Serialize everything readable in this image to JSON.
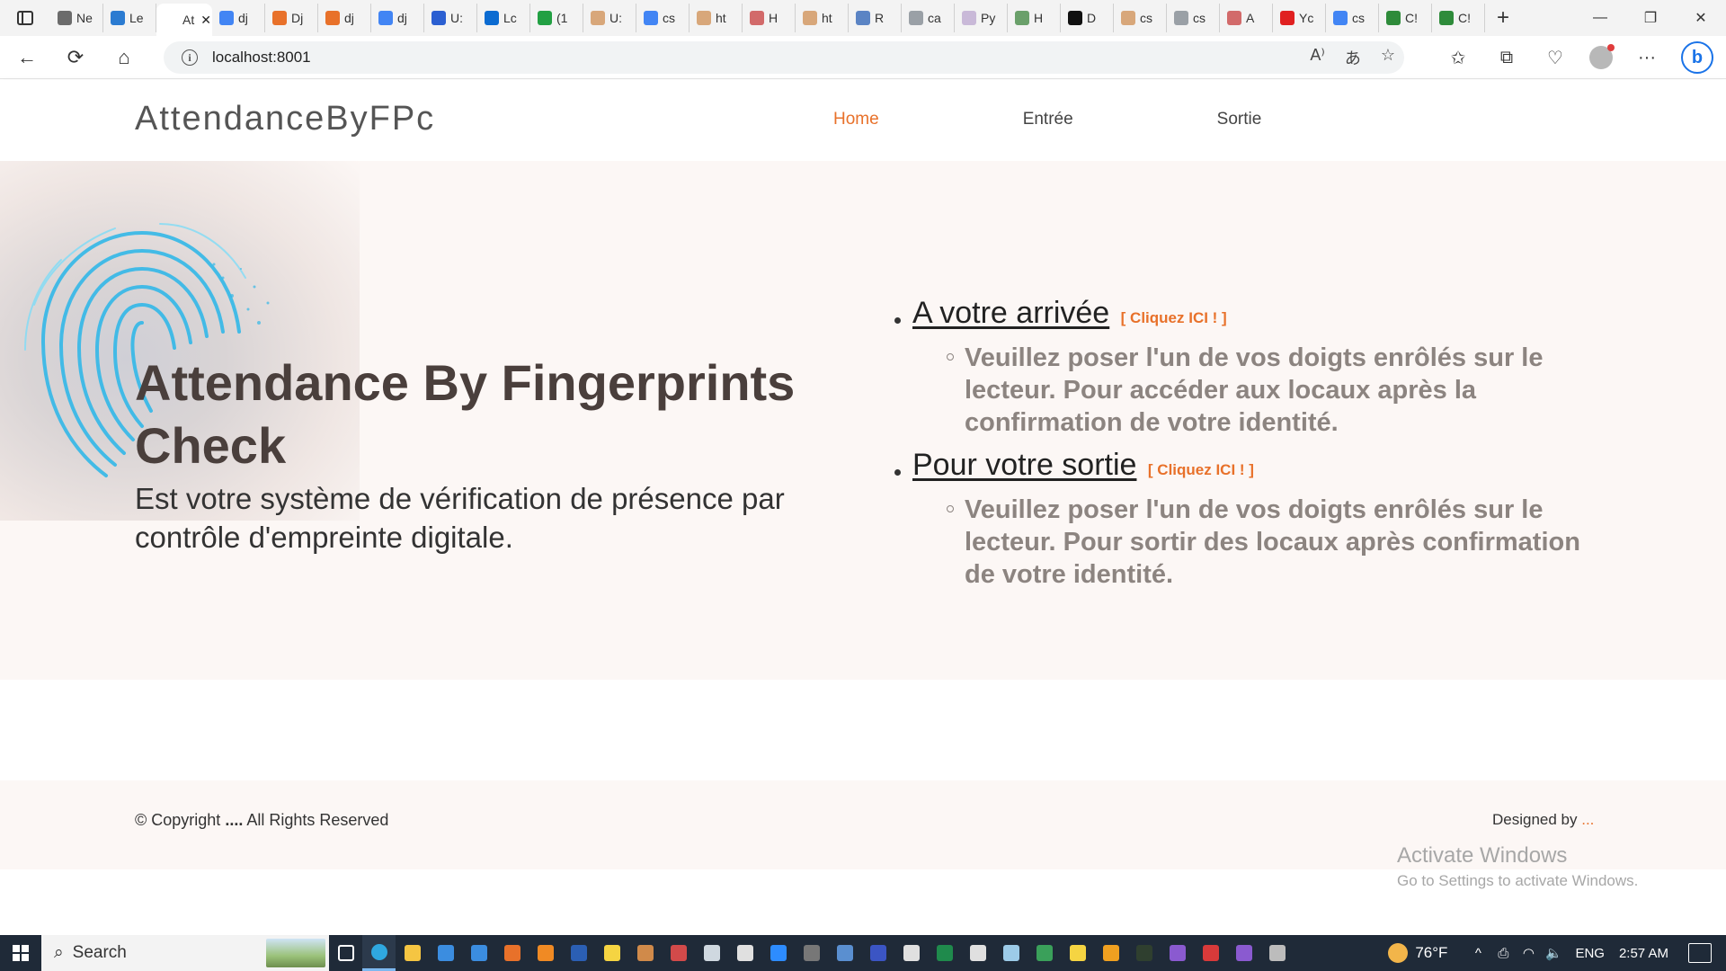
{
  "browser": {
    "tabs": [
      {
        "label": "Ne",
        "color": "#6b6b6b"
      },
      {
        "label": "Le",
        "color": "#2b7bd1"
      },
      {
        "label": "At",
        "color": "#ffffff",
        "active": true
      },
      {
        "label": "dj",
        "color": "#4285f4"
      },
      {
        "label": "Dj",
        "color": "#e8712a"
      },
      {
        "label": "dj",
        "color": "#e8712a"
      },
      {
        "label": "dj",
        "color": "#4285f4"
      },
      {
        "label": "U:",
        "color": "#2b5fd1"
      },
      {
        "label": "Lc",
        "color": "#0b6bd1"
      },
      {
        "label": "(1",
        "color": "#22a043"
      },
      {
        "label": "U:",
        "color": "#d8a77a"
      },
      {
        "label": "cs",
        "color": "#4285f4"
      },
      {
        "label": "ht",
        "color": "#d8a77a"
      },
      {
        "label": "H",
        "color": "#d26a6a"
      },
      {
        "label": "ht",
        "color": "#d8a77a"
      },
      {
        "label": "R",
        "color": "#5b84c4"
      },
      {
        "label": "ca",
        "color": "#9aa0a6"
      },
      {
        "label": "Py",
        "color": "#c9b9d8"
      },
      {
        "label": "H",
        "color": "#6aa06a"
      },
      {
        "label": "D",
        "color": "#111111"
      },
      {
        "label": "cs",
        "color": "#d8a77a"
      },
      {
        "label": "cs",
        "color": "#9aa0a6"
      },
      {
        "label": "A",
        "color": "#d26a6a"
      },
      {
        "label": "Yc",
        "color": "#e02020"
      },
      {
        "label": "cs",
        "color": "#4285f4"
      },
      {
        "label": "C!",
        "color": "#2e8b3a"
      },
      {
        "label": "C!",
        "color": "#2e8b3a"
      }
    ],
    "active_tab_close": "✕",
    "new_tab": "+",
    "window": {
      "minimize": "—",
      "restore": "❐",
      "close": "✕"
    },
    "nav": {
      "back": "←",
      "reload": "⟳",
      "home": "⌂"
    },
    "url": "localhost:8001",
    "omnibox_icons": {
      "read_aloud": "A⁾",
      "translate": "あ",
      "favorite": "☆"
    },
    "toolbar_icons": {
      "favorites": "✩",
      "collections": "⧉",
      "performance": "♡",
      "menu": "···",
      "bing": "b"
    }
  },
  "site": {
    "brand": "AttendanceByFPc",
    "nav": [
      {
        "label": "Home",
        "active": true
      },
      {
        "label": "Entrée",
        "active": false
      },
      {
        "label": "Sortie",
        "active": false
      }
    ],
    "hero": {
      "title": "Attendance By Fingerprints Check",
      "subtitle": "Est votre système de vérification de présence par contrôle d'empreinte digitale."
    },
    "steps": [
      {
        "link": "A votre arrivée",
        "cta": "[ Cliquez ICI ! ]",
        "desc": "Veuillez poser l'un de vos doigts enrôlés sur le lecteur. Pour accéder aux locaux après la confirmation de votre identité."
      },
      {
        "link": "Pour votre sortie",
        "cta": "[ Cliquez ICI ! ]",
        "desc": "Veuillez poser l'un de vos doigts enrôlés sur le lecteur. Pour sortir des locaux après confirmation de votre identité."
      }
    ],
    "footer": {
      "copyright_prefix": "© Copyright ",
      "copyright_bold": "....",
      "copyright_suffix": " All Rights Reserved",
      "designed_by": "Designed by ",
      "designer": "..."
    },
    "accent_color": "#e8712a"
  },
  "watermark": {
    "line1": "Activate Windows",
    "line2": "Go to Settings to activate Windows."
  },
  "taskbar": {
    "search_label": "Search",
    "weather": "76°F",
    "language": "ENG",
    "time": "2:57 AM",
    "tray_icons": {
      "chevron": "^",
      "meet": "⎙",
      "wifi": "◠",
      "volume": "🔈"
    },
    "apps": [
      {
        "name": "task-view",
        "color": "#ffffff"
      },
      {
        "name": "edge",
        "color": "#2fa8e0",
        "active": true
      },
      {
        "name": "file-explorer",
        "color": "#f5c542"
      },
      {
        "name": "store",
        "color": "#3b8de0"
      },
      {
        "name": "mail",
        "color": "#3b8de0"
      },
      {
        "name": "app-orange",
        "color": "#e8712a"
      },
      {
        "name": "vlc",
        "color": "#f08a24"
      },
      {
        "name": "word",
        "color": "#2b5fb4"
      },
      {
        "name": "sticky-notes",
        "color": "#f5d442"
      },
      {
        "name": "app-media",
        "color": "#d08a4a"
      },
      {
        "name": "app-red",
        "color": "#d24a4a"
      },
      {
        "name": "notepad",
        "color": "#cfd8e0"
      },
      {
        "name": "app-gear",
        "color": "#e0e0e0"
      },
      {
        "name": "zoom",
        "color": "#2d8cff"
      },
      {
        "name": "app-dark",
        "color": "#777777"
      },
      {
        "name": "app-blue",
        "color": "#5a8fd0"
      },
      {
        "name": "app-f",
        "color": "#3b55c4"
      },
      {
        "name": "app-doc",
        "color": "#e0e0e0"
      },
      {
        "name": "excel",
        "color": "#1f8a4c"
      },
      {
        "name": "app-pdf",
        "color": "#e0e0e0"
      },
      {
        "name": "app-light",
        "color": "#9ccbe8"
      },
      {
        "name": "app-green",
        "color": "#3aa05a"
      },
      {
        "name": "app-yellow",
        "color": "#f5d442"
      },
      {
        "name": "app-orange2",
        "color": "#f0a020"
      },
      {
        "name": "terminal",
        "color": "#2f3f2f"
      },
      {
        "name": "visual-studio",
        "color": "#8a5ad0"
      },
      {
        "name": "acrobat",
        "color": "#d83a3a"
      },
      {
        "name": "vs-purple",
        "color": "#8a5ad0"
      },
      {
        "name": "app-tools",
        "color": "#bcbcbc"
      }
    ]
  }
}
